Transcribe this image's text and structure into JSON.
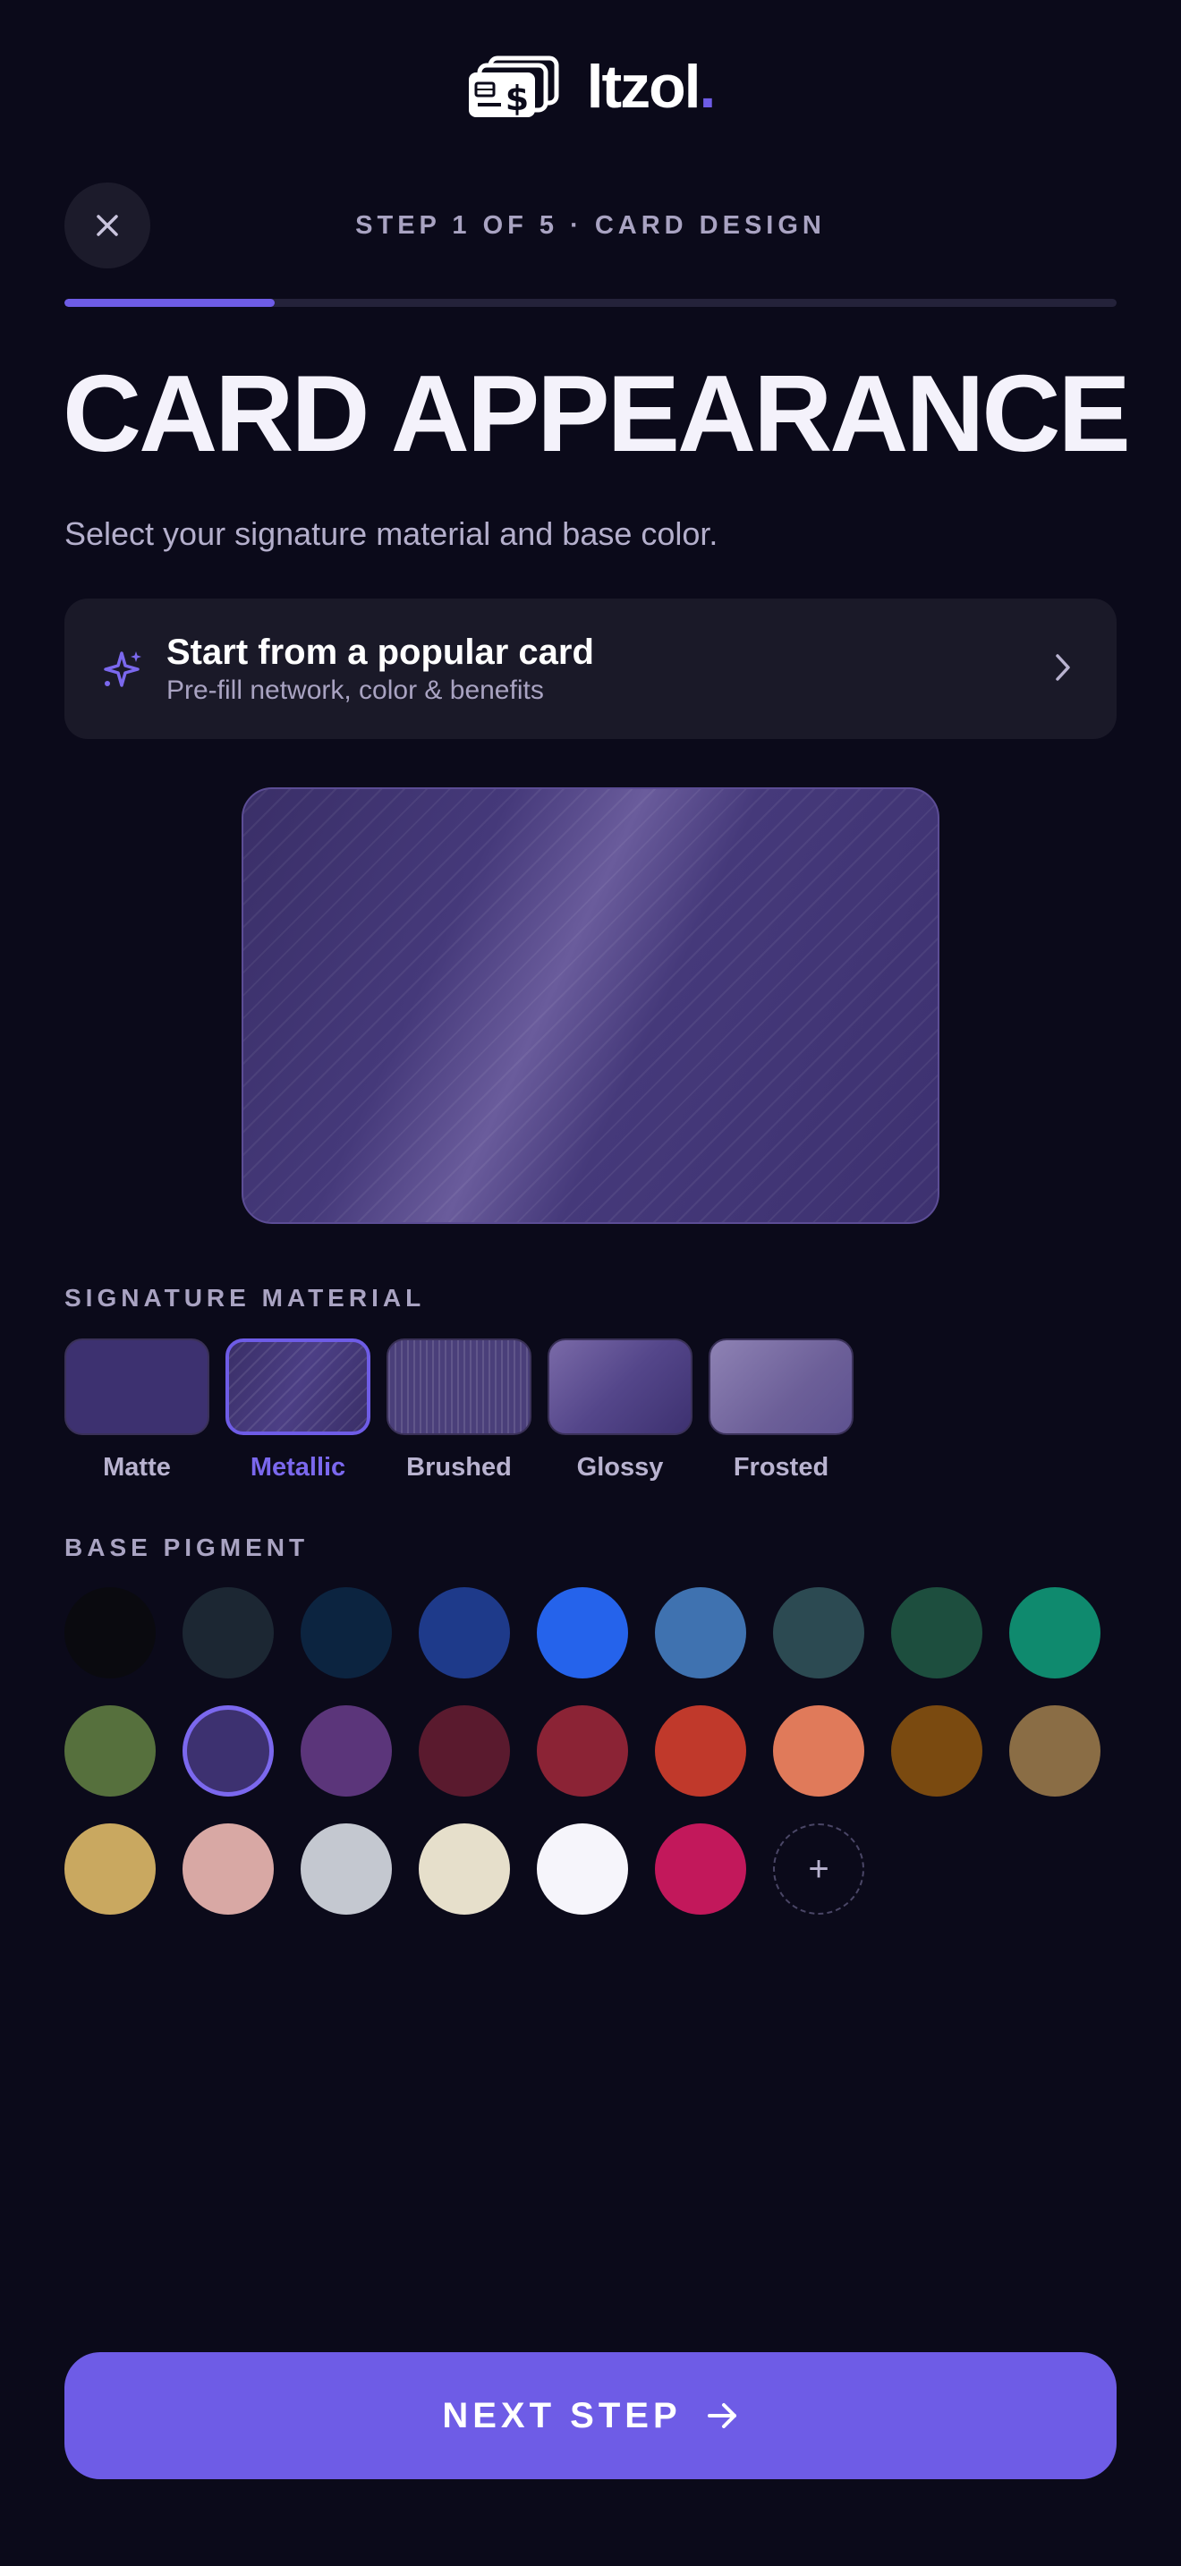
{
  "brand": {
    "name": "ltzol",
    "dot": "."
  },
  "header": {
    "step_label": "STEP 1 OF 5 · CARD DESIGN",
    "progress": 0.2
  },
  "page": {
    "title": "CARD APPEARANCE",
    "subtitle": "Select your signature material and base color."
  },
  "popular_card": {
    "title": "Start from a popular card",
    "subtitle": "Pre-fill network, color & benefits"
  },
  "materials": {
    "label": "SIGNATURE MATERIAL",
    "selected": "Metallic",
    "items": [
      {
        "name": "Matte"
      },
      {
        "name": "Metallic"
      },
      {
        "name": "Brushed"
      },
      {
        "name": "Glossy"
      },
      {
        "name": "Frosted"
      }
    ]
  },
  "pigments": {
    "label": "BASE PIGMENT",
    "selected_index": 10,
    "colors": [
      "#0a0a0f",
      "#1c2733",
      "#0c2440",
      "#1e3a8a",
      "#2563eb",
      "#3f72b0",
      "#2c4a52",
      "#1d4e3e",
      "#0f8a6e",
      "#56703d",
      "#3d3170",
      "#5b357a",
      "#5a1a2e",
      "#8b2335",
      "#c0392b",
      "#e07a5a",
      "#7a4a10",
      "#8a6d45",
      "#c9a860",
      "#d8a8a4",
      "#c4c8d0",
      "#e6dfcb",
      "#f6f5fb",
      "#c2185b"
    ],
    "add_label": "+"
  },
  "footer": {
    "next_label": "NEXT STEP"
  },
  "colors": {
    "accent": "#6e5ce6",
    "background": "#0b0a1a",
    "surface": "#1a1928"
  }
}
